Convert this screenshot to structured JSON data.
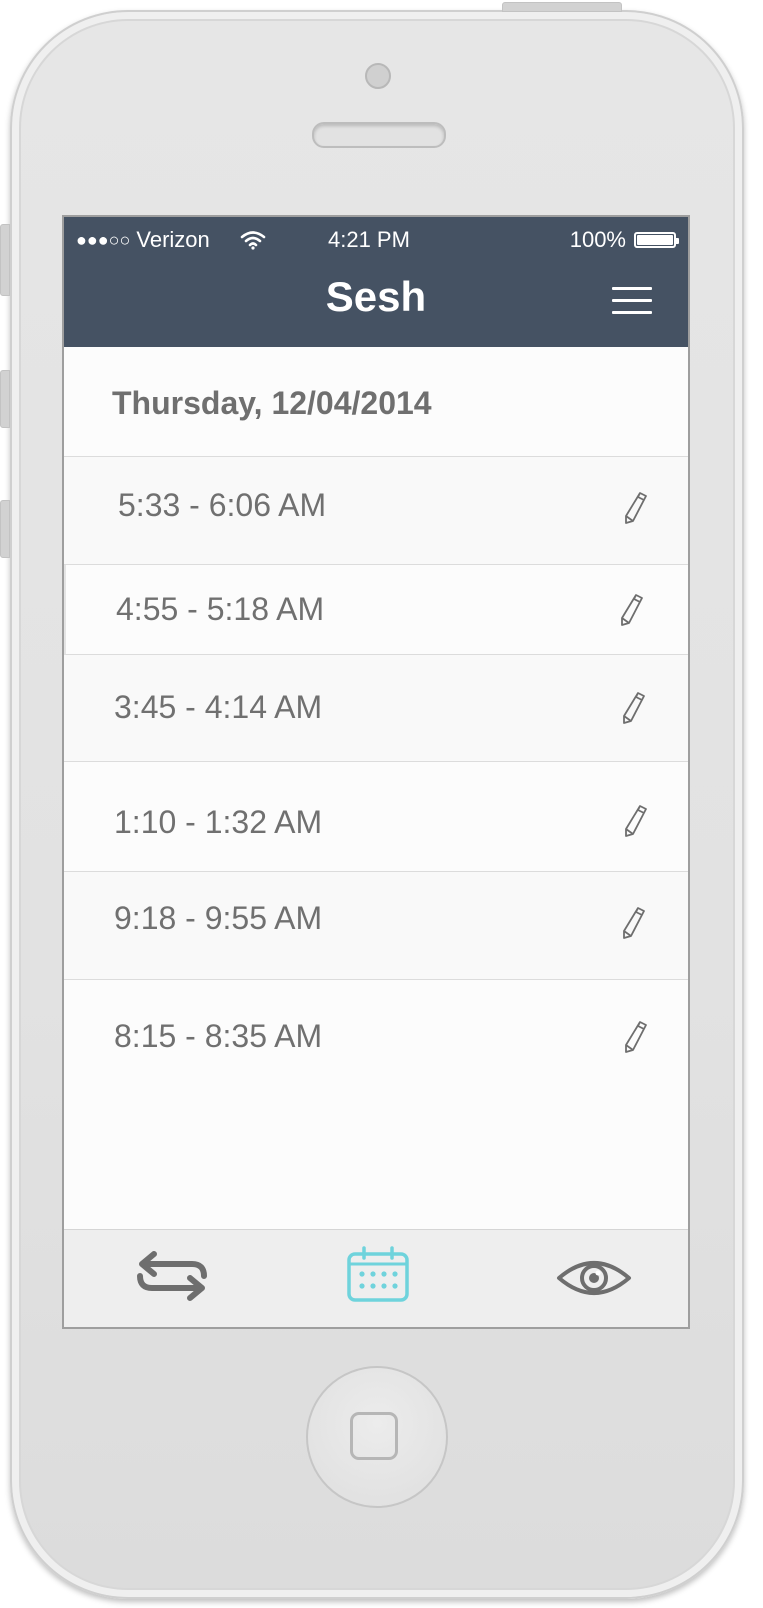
{
  "status_bar": {
    "carrier": "Verizon",
    "signal_dots": "●●●○○",
    "time": "4:21 PM",
    "battery": "100%",
    "battery_level": 1.0
  },
  "app": {
    "title": "Sesh",
    "menu_icon": "hamburger-menu-icon"
  },
  "date_header": "Thursday, 12/04/2014",
  "sessions": [
    {
      "time": "5:33 - 6:06 AM",
      "icon": "pencil-edit-icon"
    },
    {
      "time": "4:55 - 5:18 AM",
      "icon": "pencil-edit-icon"
    },
    {
      "time": "3:45 - 4:14 AM",
      "icon": "pencil-edit-icon"
    },
    {
      "time": "1:10 - 1:32 AM",
      "icon": "pencil-edit-icon"
    },
    {
      "time": "9:18 - 9:55 AM",
      "icon": "pencil-edit-icon"
    },
    {
      "time": "8:15 - 8:35 AM",
      "icon": "pencil-edit-icon"
    }
  ],
  "tab_bar": [
    {
      "name": "transfer",
      "icon": "swap-arrows-icon",
      "active": false
    },
    {
      "name": "calendar",
      "icon": "calendar-icon",
      "active": true
    },
    {
      "name": "view",
      "icon": "eye-icon",
      "active": false
    }
  ],
  "colors": {
    "header": "#455263",
    "accent": "#6fd3dc",
    "text": "#707070",
    "icon": "#6e6e6e"
  }
}
